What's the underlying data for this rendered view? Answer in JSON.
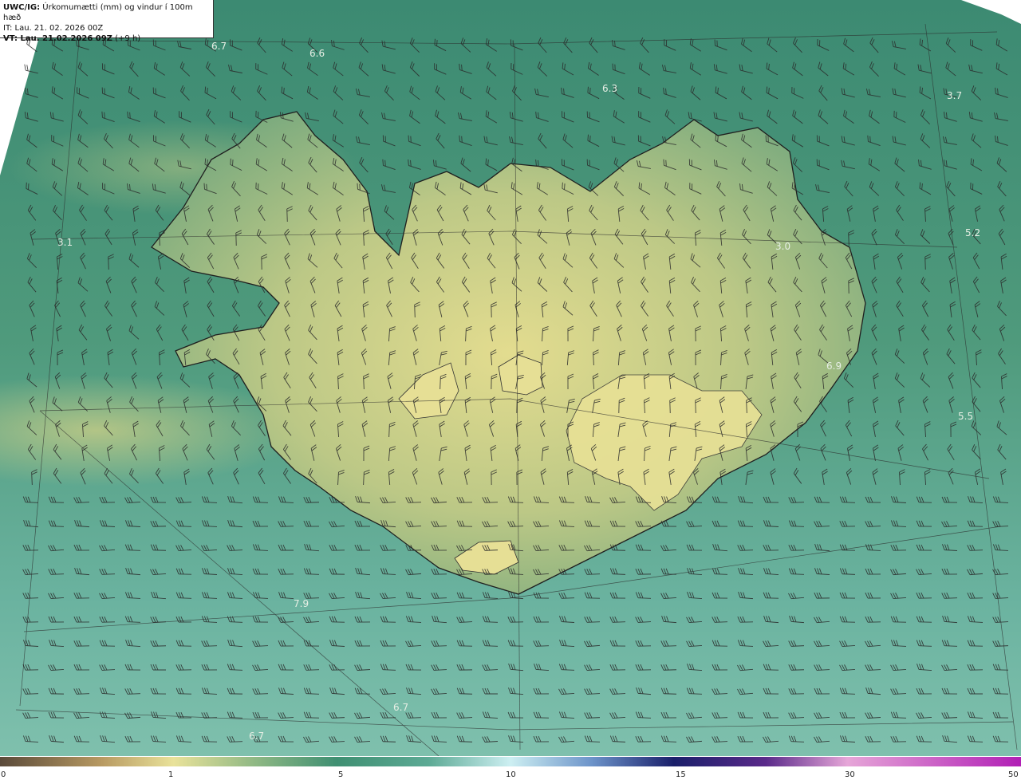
{
  "header": {
    "product": "UWC/IG:",
    "title": "Úrkomumætti (mm) og vindur í 100m hæð",
    "init_time": "IT: Lau. 21. 02. 2026 00Z",
    "valid_prefix": "VT: Lau. 21.02.2026 09Z",
    "valid_suffix": " (+9 h)"
  },
  "map": {
    "region": "Iceland",
    "background_colors": {
      "low": "#3b8a6e",
      "mid": "#6fa87c",
      "high": "#e6dd8c",
      "sea_light": "#8ec9b8",
      "coast": "#222222"
    },
    "field_labels": [
      {
        "text": "6.7"
      },
      {
        "text": "6.6"
      },
      {
        "text": "6.3"
      },
      {
        "text": "3.7"
      },
      {
        "text": "3.1"
      },
      {
        "text": "5.2"
      },
      {
        "text": "3.0"
      },
      {
        "text": "6.9"
      },
      {
        "text": "5.5"
      },
      {
        "text": "7.9"
      },
      {
        "text": "6.7"
      },
      {
        "text": "6.7"
      }
    ]
  },
  "colorbar": {
    "ticks": [
      "0",
      "1",
      "5",
      "10",
      "15",
      "30",
      "50"
    ],
    "colors": [
      "#5a4a3a",
      "#c9a76a",
      "#e9e29a",
      "#3f8f72",
      "#7fc6b9",
      "#cdeff2",
      "#1f2a6b",
      "#3a1a6e",
      "#e6a6d8",
      "#b11fb5"
    ]
  }
}
